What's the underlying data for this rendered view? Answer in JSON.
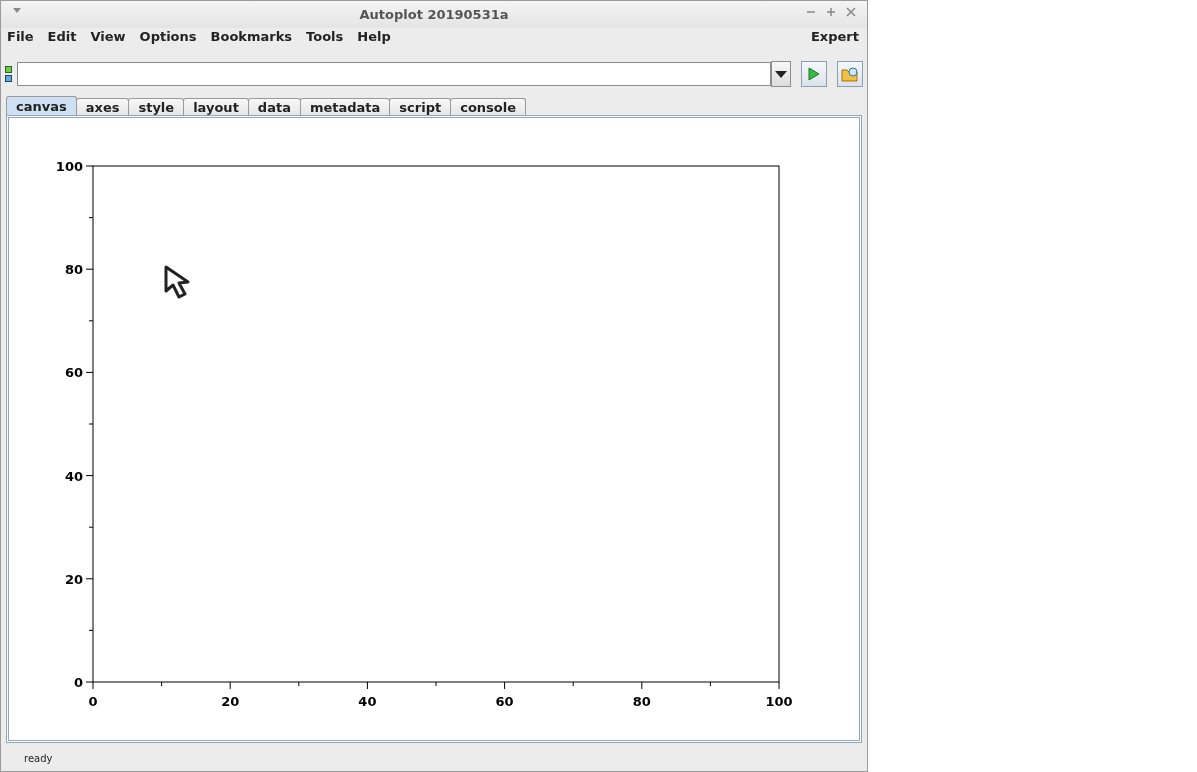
{
  "window": {
    "title": "Autoplot 20190531a"
  },
  "menu": {
    "items": [
      "File",
      "Edit",
      "View",
      "Options",
      "Bookmarks",
      "Tools",
      "Help"
    ],
    "right": "Expert"
  },
  "tabs": [
    {
      "label": "canvas",
      "selected": true
    },
    {
      "label": "axes",
      "selected": false
    },
    {
      "label": "style",
      "selected": false
    },
    {
      "label": "layout",
      "selected": false
    },
    {
      "label": "data",
      "selected": false
    },
    {
      "label": "metadata",
      "selected": false
    },
    {
      "label": "script",
      "selected": false
    },
    {
      "label": "console",
      "selected": false
    }
  ],
  "plot": {
    "chart_data": {
      "type": "line",
      "xlim": [
        0,
        100
      ],
      "ylim": [
        0,
        100
      ],
      "xticks": [
        0,
        20,
        40,
        60,
        80,
        100
      ],
      "yticks": [
        0,
        20,
        40,
        60,
        80,
        100
      ]
    }
  },
  "status_bar": {
    "text": "ready"
  }
}
